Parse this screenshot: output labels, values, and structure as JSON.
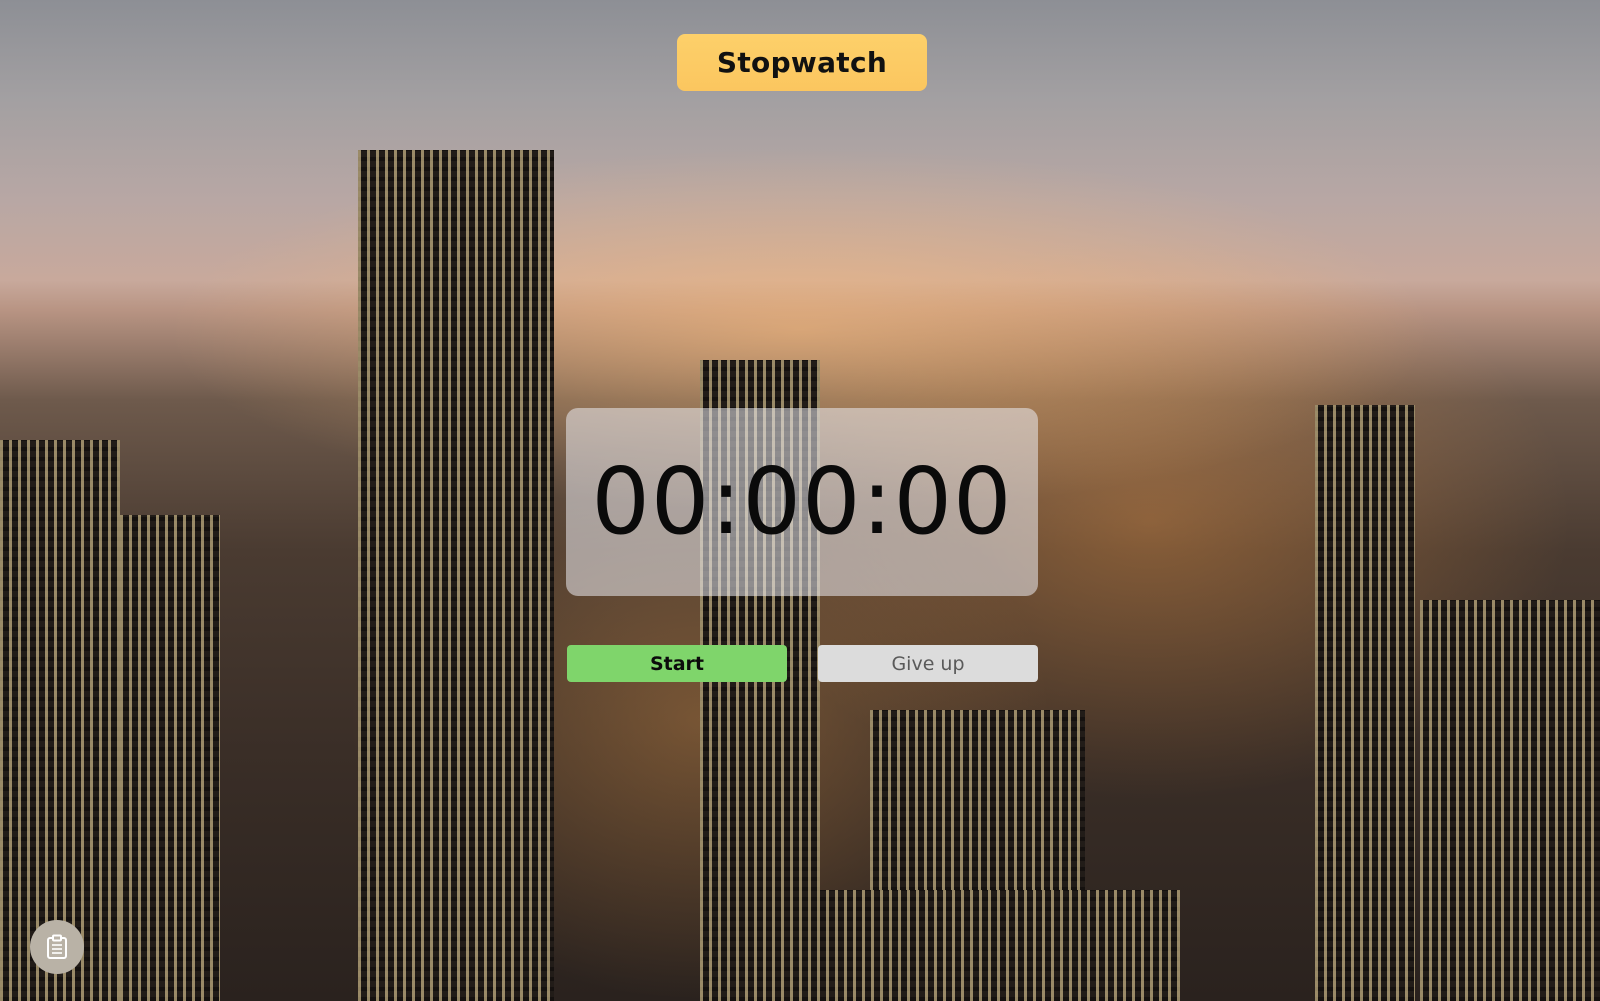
{
  "header": {
    "title": "Stopwatch"
  },
  "timer": {
    "display": "00:00:00"
  },
  "controls": {
    "start_label": "Start",
    "give_up_label": "Give up"
  },
  "floating_button": {
    "icon": "clipboard-icon"
  },
  "colors": {
    "title_badge": "#fbc65f",
    "start_button": "#7fd56b",
    "give_up_button": "#dcdcdc"
  }
}
